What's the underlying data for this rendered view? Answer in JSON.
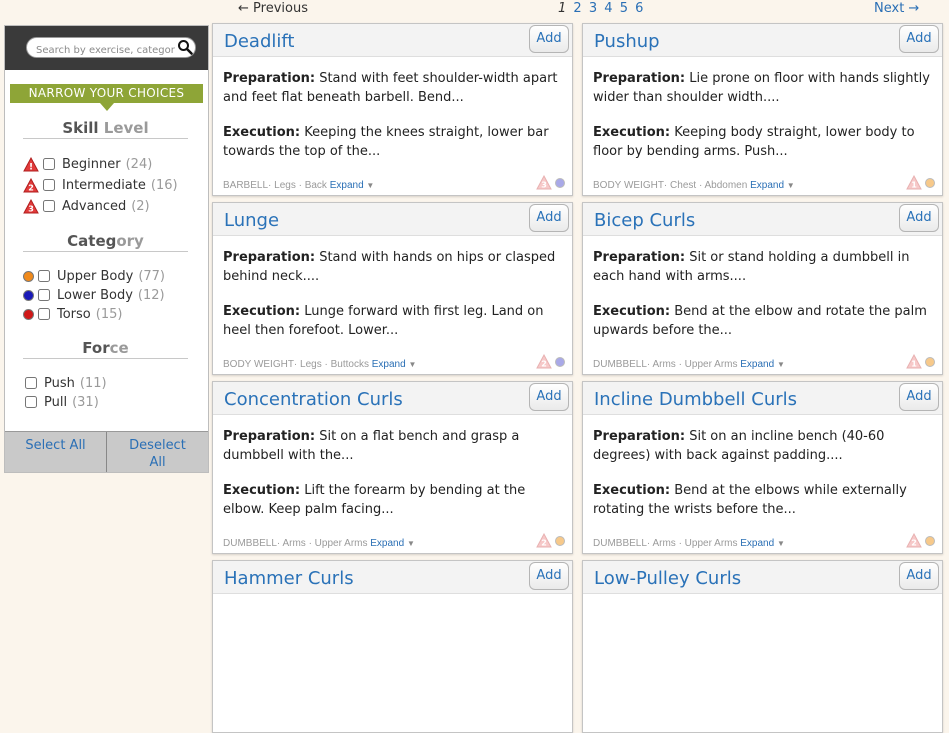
{
  "search": {
    "placeholder": "Search by exercise, category..."
  },
  "sidebar": {
    "banner": "NARROW YOUR CHOICES",
    "skill": {
      "title_main": "Skill",
      "title_dim": " Level",
      "items": [
        {
          "label": "Beginner",
          "count": "(24)",
          "level": "1"
        },
        {
          "label": "Intermediate",
          "count": "(16)",
          "level": "2"
        },
        {
          "label": "Advanced",
          "count": "(2)",
          "level": "3"
        }
      ]
    },
    "category": {
      "title_main": "Categ",
      "title_dim": "ory",
      "items": [
        {
          "label": "Upper Body",
          "count": "(77)",
          "color": "#f08a1c"
        },
        {
          "label": "Lower Body",
          "count": "(12)",
          "color": "#1a1ab8"
        },
        {
          "label": "Torso",
          "count": "(15)",
          "color": "#d01818"
        }
      ]
    },
    "force": {
      "title_main": "For",
      "title_dim": "ce",
      "items": [
        {
          "label": "Push",
          "count": "(11)"
        },
        {
          "label": "Pull",
          "count": "(31)"
        }
      ]
    },
    "select_all": "Select All",
    "deselect_all": "Deselect All"
  },
  "pagination": {
    "prev": "← Previous",
    "next": "Next →",
    "pages": [
      "1",
      "2",
      "3",
      "4",
      "5",
      "6"
    ],
    "current": "1"
  },
  "cards": [
    {
      "title": "Deadlift",
      "add": "Add",
      "prep_label": "Preparation:",
      "prep": " Stand with feet shoulder-width apart and feet flat beneath barbell. Bend...",
      "exec_label": "Execution:",
      "exec": " Keeping the knees straight, lower bar towards the top of the...",
      "tags": "BARBELL· Legs · Back",
      "expand": "Expand",
      "level": "3",
      "dot_color": "#a9a9e8"
    },
    {
      "title": "Pushup",
      "add": "Add",
      "prep_label": "Preparation:",
      "prep": " Lie prone on floor with hands slightly wider than shoulder width....",
      "exec_label": "Execution:",
      "exec": " Keeping body straight, lower body to floor by bending arms. Push...",
      "tags": "BODY WEIGHT· Chest · Abdomen",
      "expand": "Expand",
      "level": "1",
      "dot_color": "#f7c98a"
    },
    {
      "title": "Lunge",
      "add": "Add",
      "prep_label": "Preparation:",
      "prep": " Stand with hands on hips or clasped behind neck....",
      "exec_label": "Execution:",
      "exec": " Lunge forward with first leg. Land on heel then forefoot. Lower...",
      "tags": "BODY WEIGHT· Legs · Buttocks",
      "expand": "Expand",
      "level": "2",
      "dot_color": "#a9a9e8"
    },
    {
      "title": "Bicep Curls",
      "add": "Add",
      "prep_label": "Preparation:",
      "prep": " Sit or stand holding a dumbbell in each hand with arms....",
      "exec_label": "Execution:",
      "exec": " Bend at the elbow and rotate the palm upwards before the...",
      "tags": "DUMBBELL· Arms · Upper Arms",
      "expand": "Expand",
      "level": "1",
      "dot_color": "#f7c98a"
    },
    {
      "title": "Concentration Curls",
      "add": "Add",
      "prep_label": "Preparation:",
      "prep": " Sit on a flat bench and grasp a dumbbell with the...",
      "exec_label": "Execution:",
      "exec": " Lift the forearm by bending at the elbow. Keep palm facing...",
      "tags": "DUMBBELL· Arms · Upper Arms",
      "expand": "Expand",
      "level": "2",
      "dot_color": "#f7c98a"
    },
    {
      "title": "Incline Dumbbell Curls",
      "add": "Add",
      "prep_label": "Preparation:",
      "prep": " Sit on an incline bench (40-60 degrees) with back against padding....",
      "exec_label": "Execution:",
      "exec": " Bend at the elbows while externally rotating the wrists before the...",
      "tags": "DUMBBELL· Arms · Upper Arms",
      "expand": "Expand",
      "level": "2",
      "dot_color": "#f7c98a"
    },
    {
      "title": "Hammer Curls",
      "add": "Add"
    },
    {
      "title": "Low-Pulley Curls",
      "add": "Add"
    }
  ]
}
